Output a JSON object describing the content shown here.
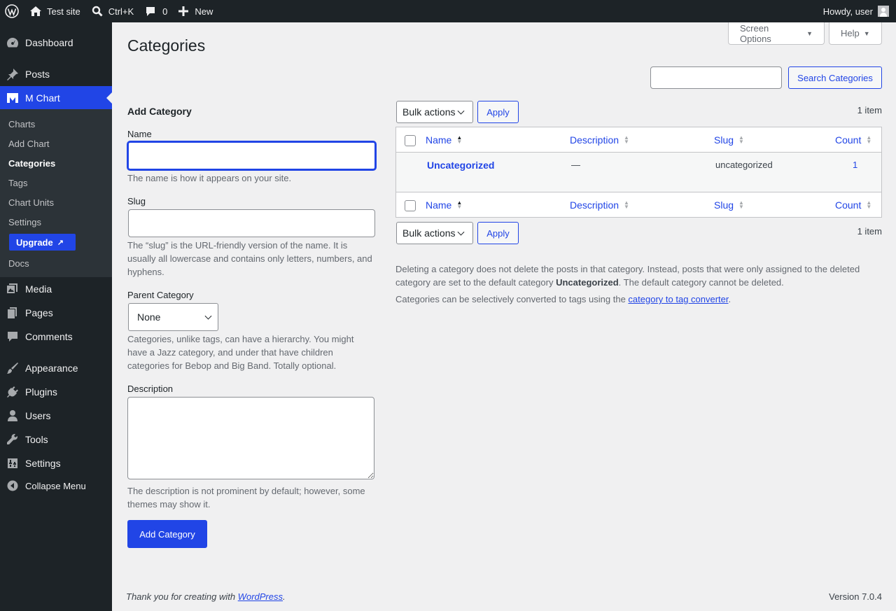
{
  "adminbar": {
    "site_name": "Test site",
    "search_shortcut": "Ctrl+K",
    "comments_count": "0",
    "new_label": "New",
    "greeting": "Howdy, user"
  },
  "sidebar": {
    "items": [
      {
        "label": "Dashboard",
        "icon": "dashboard-icon"
      },
      {
        "label": "Posts",
        "icon": "pushpin-icon"
      },
      {
        "label": "M Chart",
        "icon": "m-chart-icon"
      },
      {
        "label": "Media",
        "icon": "media-icon"
      },
      {
        "label": "Pages",
        "icon": "pages-icon"
      },
      {
        "label": "Comments",
        "icon": "comment-icon"
      },
      {
        "label": "Appearance",
        "icon": "brush-icon"
      },
      {
        "label": "Plugins",
        "icon": "plugin-icon"
      },
      {
        "label": "Users",
        "icon": "user-icon"
      },
      {
        "label": "Tools",
        "icon": "wrench-icon"
      },
      {
        "label": "Settings",
        "icon": "sliders-icon"
      },
      {
        "label": "Collapse Menu",
        "icon": "collapse-icon"
      }
    ],
    "submenu": [
      "Charts",
      "Add Chart",
      "Categories",
      "Tags",
      "Chart Units",
      "Settings",
      "Docs"
    ],
    "upgrade_label": "Upgrade"
  },
  "header": {
    "title": "Categories",
    "screen_options": "Screen Options",
    "help": "Help"
  },
  "search": {
    "value": "",
    "button_label": "Search Categories"
  },
  "form": {
    "heading": "Add Category",
    "name_label": "Name",
    "name_value": "",
    "name_help": "The name is how it appears on your site.",
    "slug_label": "Slug",
    "slug_value": "",
    "slug_help": "The “slug” is the URL-friendly version of the name. It is usually all lowercase and contains only letters, numbers, and hyphens.",
    "parent_label": "Parent Category",
    "parent_selected": "None",
    "parent_help": "Categories, unlike tags, can have a hierarchy. You might have a Jazz category, and under that have children categories for Bebop and Big Band. Totally optional.",
    "description_label": "Description",
    "description_value": "",
    "description_help": "The description is not prominent by default; however, some themes may show it.",
    "submit_label": "Add Category"
  },
  "table": {
    "bulk_actions": "Bulk actions",
    "apply": "Apply",
    "item_count": "1 item",
    "columns": [
      "Name",
      "Description",
      "Slug",
      "Count"
    ],
    "rows": [
      {
        "name": "Uncategorized",
        "description": "—",
        "slug": "uncategorized",
        "count": "1"
      }
    ]
  },
  "notes": {
    "p1_before": "Deleting a category does not delete the posts in that category. Instead, posts that were only assigned to the deleted category are set to the default category ",
    "p1_bold": "Uncategorized",
    "p1_after": ". The default category cannot be deleted.",
    "p2_before": "Categories can be selectively converted to tags using the ",
    "p2_link": "category to tag converter",
    "p2_after": "."
  },
  "footer": {
    "thanks_before": "Thank you for creating with ",
    "thanks_link": "WordPress",
    "thanks_after": ".",
    "version": "Version 7.0.4"
  }
}
